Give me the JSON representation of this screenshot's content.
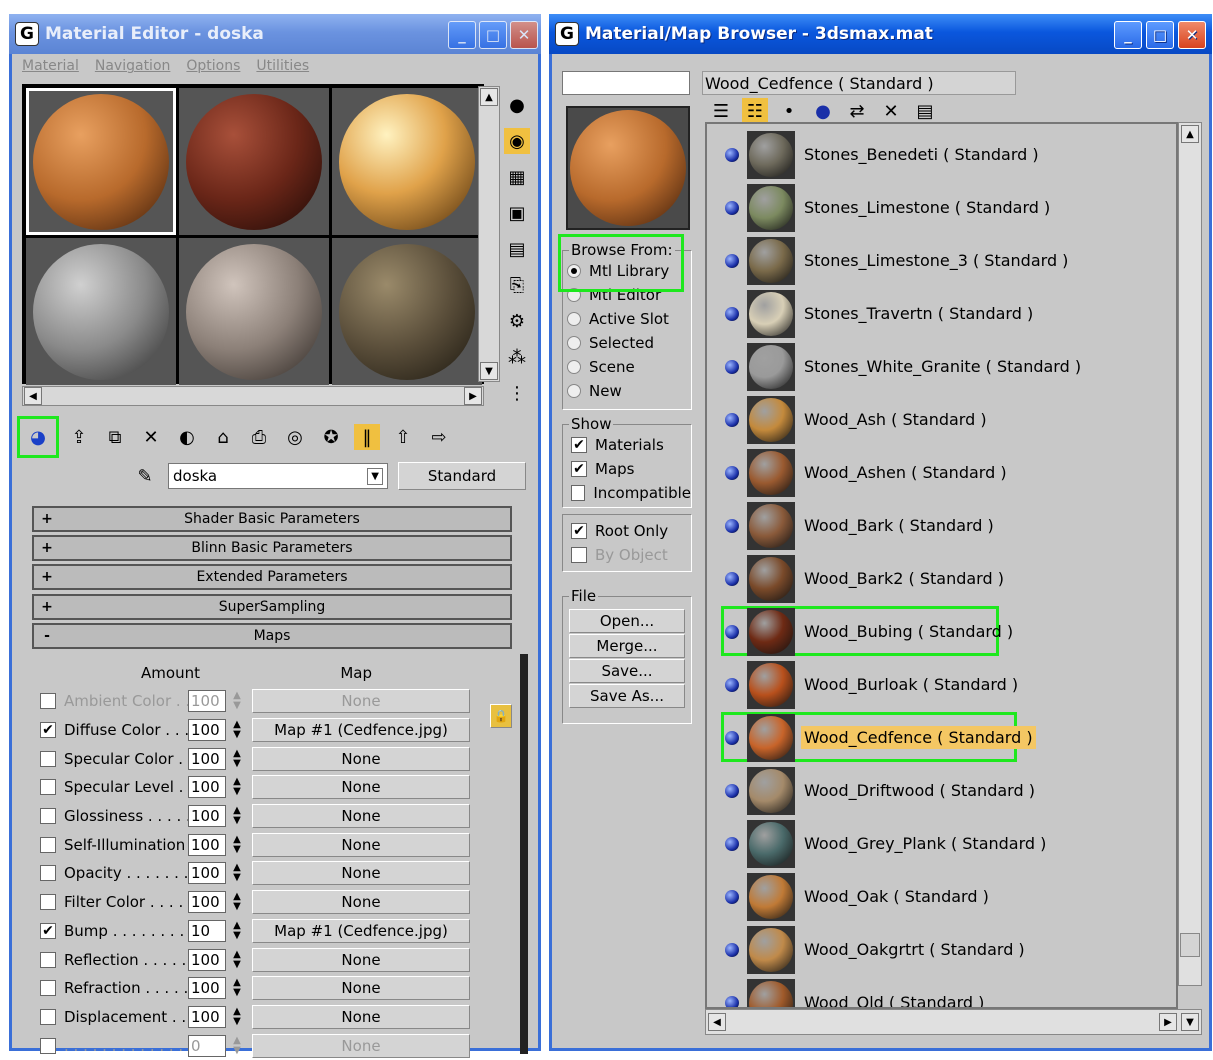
{
  "left_window": {
    "title": "Material Editor - doska",
    "menu": [
      "Material",
      "Navigation",
      "Options",
      "Utilities"
    ],
    "material_name": "doska",
    "material_type": "Standard",
    "rollouts": [
      {
        "sign": "+",
        "label": "Shader Basic Parameters"
      },
      {
        "sign": "+",
        "label": "Blinn Basic Parameters"
      },
      {
        "sign": "+",
        "label": "Extended Parameters"
      },
      {
        "sign": "+",
        "label": "SuperSampling"
      },
      {
        "sign": "-",
        "label": "Maps"
      }
    ],
    "maps_headers": {
      "amount": "Amount",
      "map": "Map"
    },
    "maps": [
      {
        "label": "Ambient Color . . .",
        "checked": false,
        "amount": "100",
        "map": "None",
        "dim": true
      },
      {
        "label": "Diffuse Color . . . .",
        "checked": true,
        "amount": "100",
        "map": "Map #1 (Cedfence.jpg)"
      },
      {
        "label": "Specular Color . .",
        "checked": false,
        "amount": "100",
        "map": "None"
      },
      {
        "label": "Specular Level .",
        "checked": false,
        "amount": "100",
        "map": "None"
      },
      {
        "label": "Glossiness . . . . .",
        "checked": false,
        "amount": "100",
        "map": "None"
      },
      {
        "label": "Self-Illumination .",
        "checked": false,
        "amount": "100",
        "map": "None"
      },
      {
        "label": "Opacity . . . . . . .",
        "checked": false,
        "amount": "100",
        "map": "None"
      },
      {
        "label": "Filter Color . . . . .",
        "checked": false,
        "amount": "100",
        "map": "None"
      },
      {
        "label": "Bump . . . . . . . . .",
        "checked": true,
        "amount": "10",
        "map": "Map #1 (Cedfence.jpg)"
      },
      {
        "label": "Reflection . . . . .",
        "checked": false,
        "amount": "100",
        "map": "None"
      },
      {
        "label": "Refraction . . . . .",
        "checked": false,
        "amount": "100",
        "map": "None"
      },
      {
        "label": "Displacement . .",
        "checked": false,
        "amount": "100",
        "map": "None"
      },
      {
        "label": ". . . . . . . . . . . . .",
        "checked": false,
        "amount": "0",
        "map": "None",
        "dim": true
      }
    ]
  },
  "right_window": {
    "title": "Material/Map Browser - 3dsmax.mat",
    "search_value": "",
    "current_label": "Wood_Cedfence  ( Standard )",
    "browse_from": {
      "title": "Browse From:",
      "options": [
        "Mtl Library",
        "Mtl Editor",
        "Active Slot",
        "Selected",
        "Scene",
        "New"
      ],
      "selected": "Mtl Library"
    },
    "show": {
      "title": "Show",
      "options": [
        {
          "label": "Materials",
          "checked": true
        },
        {
          "label": "Maps",
          "checked": true
        },
        {
          "label": "Incompatible",
          "checked": false
        }
      ]
    },
    "root": [
      {
        "label": "Root Only",
        "checked": true
      },
      {
        "label": "By Object",
        "checked": false,
        "dim": true
      }
    ],
    "file": {
      "title": "File",
      "buttons": [
        "Open...",
        "Merge...",
        "Save...",
        "Save As..."
      ]
    },
    "items": [
      {
        "name": "Stones_Benedeti  ( Standard )",
        "color": "#6e6a5c"
      },
      {
        "name": "Stones_Limestone  ( Standard )",
        "color": "#7c8a60"
      },
      {
        "name": "Stones_Limestone_3  ( Standard )",
        "color": "#7a6a4a"
      },
      {
        "name": "Stones_Travertn  ( Standard )",
        "color": "#d8cfb6"
      },
      {
        "name": "Stones_White_Granite  ( Standard )",
        "color": "#9a9a9a"
      },
      {
        "name": "Wood_Ash  ( Standard )",
        "color": "#c48a3c"
      },
      {
        "name": "Wood_Ashen  ( Standard )",
        "color": "#9a5a30"
      },
      {
        "name": "Wood_Bark  ( Standard )",
        "color": "#8a5a3a"
      },
      {
        "name": "Wood_Bark2  ( Standard )",
        "color": "#7a4a2a"
      },
      {
        "name": "Wood_Bubing  ( Standard )",
        "color": "#6e2a14",
        "highlight": true
      },
      {
        "name": "Wood_Burloak  ( Standard )",
        "color": "#b8501c"
      },
      {
        "name": "Wood_Cedfence  ( Standard )",
        "color": "#c8642a",
        "highlight": true,
        "current": true
      },
      {
        "name": "Wood_Driftwood  ( Standard )",
        "color": "#a48a6a"
      },
      {
        "name": "Wood_Grey_Plank  ( Standard )",
        "color": "#4a6a6a"
      },
      {
        "name": "Wood_Oak  ( Standard )",
        "color": "#c07a36"
      },
      {
        "name": "Wood_Oakgrtrt  ( Standard )",
        "color": "#c08a4a"
      },
      {
        "name": "Wood_Old  ( Standard )",
        "color": "#a05a2a"
      }
    ]
  },
  "slot_colors": [
    "#b86a2c",
    "#6a2618",
    "#e0a24a",
    "#8a8a8a",
    "#8c8078",
    "#5a4e3a"
  ],
  "accent": "#1ee81e"
}
